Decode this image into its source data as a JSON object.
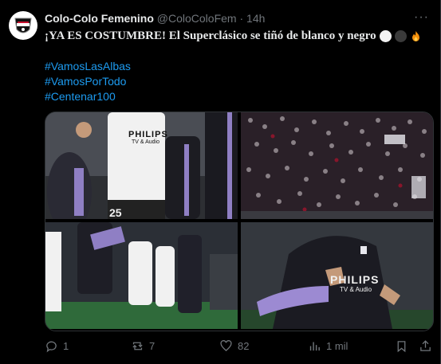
{
  "tweet": {
    "display_name": "Colo-Colo Femenino",
    "handle": "@ColoColoFem",
    "separator": "·",
    "time": "14h",
    "text": "¡YA ES COSTUMBRE! El Superclásico se tiñó de blanco y negro",
    "hashtags": [
      "#VamosLasAlbas",
      "#VamosPorTodo",
      "#Centenar100"
    ],
    "jersey_sponsor": "PHILIPS",
    "jersey_sponsor_sub": "TV & Audio",
    "jersey_number": "25"
  },
  "actions": {
    "replies": "1",
    "reposts": "7",
    "likes": "82",
    "views": "1 mil"
  },
  "colors": {
    "background": "#000000",
    "text": "#e7e9ea",
    "muted": "#71767b",
    "link": "#1d9bf0",
    "border": "#2f3336"
  }
}
